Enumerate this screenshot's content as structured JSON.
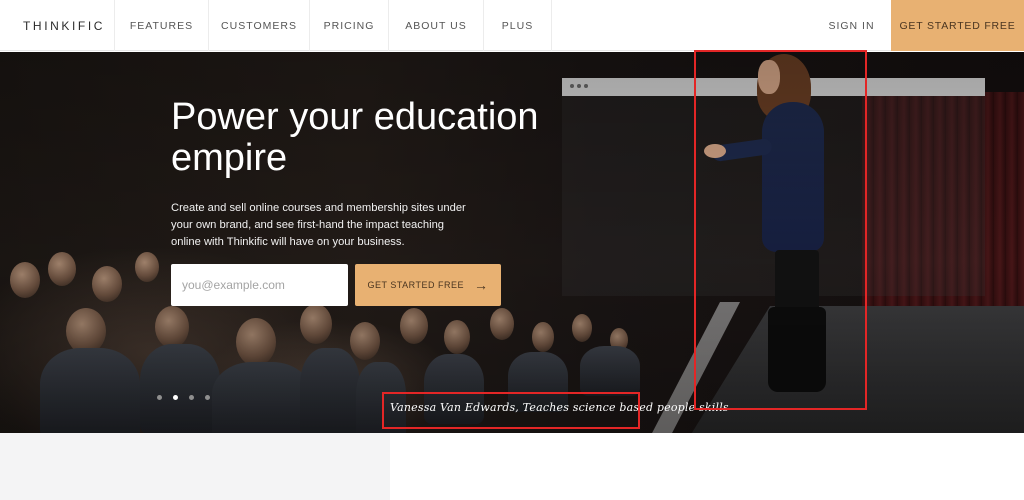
{
  "nav": {
    "logo": "THINKIFIC",
    "items": [
      {
        "label": "FEATURES"
      },
      {
        "label": "CUSTOMERS"
      },
      {
        "label": "PRICING"
      },
      {
        "label": "ABOUT US"
      },
      {
        "label": "PLUS"
      }
    ],
    "sign_in": "SIGN IN",
    "cta": "GET STARTED FREE"
  },
  "hero": {
    "title": "Power your education empire",
    "description": "Create and sell online courses and membership sites under your own brand, and see first-hand the impact teaching online with Thinkific will have on your business.",
    "email_placeholder": "you@example.com",
    "cta": "GET STARTED FREE",
    "cta_icon": "arrow-right-icon",
    "caption": "Vanessa Van Edwards, Teaches science based people skills",
    "slides": {
      "count": 4,
      "active": 2
    }
  },
  "colors": {
    "accent": "#e8b172",
    "highlight": "#e32626",
    "text_dark": "#2c2c2c"
  }
}
